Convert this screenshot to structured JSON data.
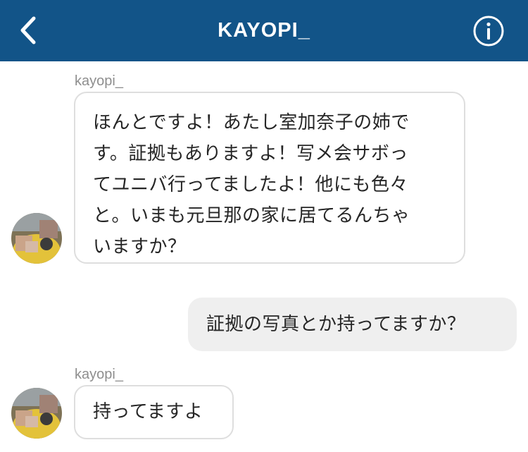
{
  "header": {
    "title": "KAYOPI_",
    "background": "#125488",
    "back_icon": "chevron-left-icon",
    "info_icon": "info-icon"
  },
  "messages": [
    {
      "direction": "incoming",
      "sender": "kayopi_",
      "lines": [
        "ほんとですよ！あたし室加奈子の姉で",
        "す。証拠もありますよ！写メ会サボっ",
        "てユニバ行ってましたよ！他にも色々",
        "と。いまも元旦那の家に居てるんちゃ",
        "いますか？"
      ]
    },
    {
      "direction": "outgoing",
      "lines": [
        "証拠の写真とか持ってますか？"
      ]
    },
    {
      "direction": "incoming",
      "sender": "kayopi_",
      "lines": [
        "持ってますよ"
      ]
    }
  ]
}
